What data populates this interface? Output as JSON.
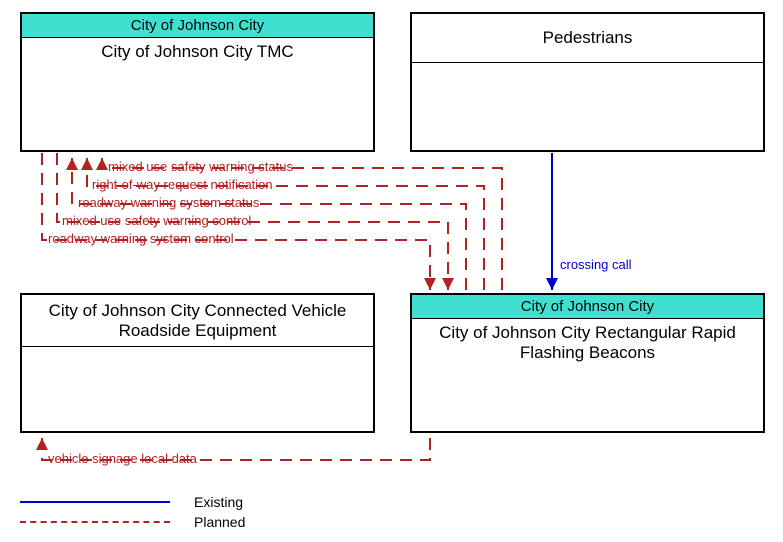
{
  "nodes": {
    "tmc": {
      "header": "City of Johnson City",
      "title": "City of Johnson City TMC"
    },
    "pedestrians": {
      "title": "Pedestrians"
    },
    "cv_rse": {
      "title": "City of Johnson City Connected Vehicle Roadside Equipment"
    },
    "rrfb": {
      "header": "City of Johnson City",
      "title": "City of Johnson City Rectangular Rapid Flashing Beacons"
    }
  },
  "flows": {
    "mixed_use_status": "mixed use safety warning status",
    "row_request": "right-of-way request notification",
    "roadway_status": "roadway warning system status",
    "mixed_use_control": "mixed use safety warning control",
    "roadway_control": "roadway warning system control",
    "crossing_call": "crossing call",
    "vehicle_signage": "vehicle signage local data"
  },
  "legend": {
    "existing": "Existing",
    "planned": "Planned"
  },
  "chart_data": {
    "type": "table",
    "title": "Context diagram — interconnect flows",
    "entities": [
      {
        "id": "tmc",
        "name": "City of Johnson City TMC",
        "owner": "City of Johnson City"
      },
      {
        "id": "pedestrians",
        "name": "Pedestrians",
        "owner": null
      },
      {
        "id": "cv_rse",
        "name": "City of Johnson City Connected Vehicle Roadside Equipment",
        "owner": null
      },
      {
        "id": "rrfb",
        "name": "City of Johnson City Rectangular Rapid Flashing Beacons",
        "owner": "City of Johnson City"
      }
    ],
    "flows": [
      {
        "from": "rrfb",
        "to": "tmc",
        "label": "mixed use safety warning status",
        "status": "Planned"
      },
      {
        "from": "rrfb",
        "to": "tmc",
        "label": "right-of-way request notification",
        "status": "Planned"
      },
      {
        "from": "rrfb",
        "to": "tmc",
        "label": "roadway warning system status",
        "status": "Planned"
      },
      {
        "from": "tmc",
        "to": "rrfb",
        "label": "mixed use safety warning control",
        "status": "Planned"
      },
      {
        "from": "tmc",
        "to": "rrfb",
        "label": "roadway warning system control",
        "status": "Planned"
      },
      {
        "from": "pedestrians",
        "to": "rrfb",
        "label": "crossing call",
        "status": "Existing"
      },
      {
        "from": "rrfb",
        "to": "cv_rse",
        "label": "vehicle signage local data",
        "status": "Planned"
      }
    ]
  }
}
